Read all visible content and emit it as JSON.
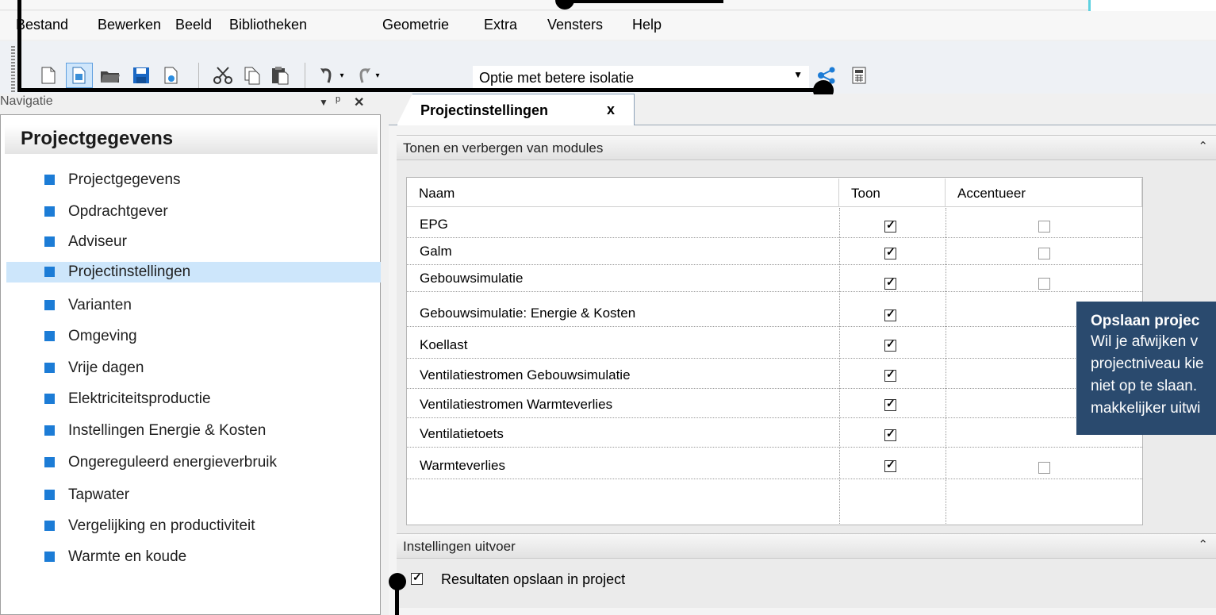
{
  "menu": [
    "Bestand",
    "Bewerken",
    "Beeld",
    "Bibliotheken",
    "Geometrie",
    "Extra",
    "Vensters",
    "Help"
  ],
  "toolbar": {
    "variant_value": "Optie met betere isolatie"
  },
  "navigation": {
    "title": "Navigatie",
    "heading": "Projectgegevens",
    "items": [
      "Projectgegevens",
      "Opdrachtgever",
      "Adviseur",
      "Projectinstellingen",
      "Varianten",
      "Omgeving",
      "Vrije dagen",
      "Elektriciteitsproductie",
      "Instellingen Energie & Kosten",
      "Ongereguleerd energieverbruik",
      "Tapwater",
      "Vergelijking en productiviteit",
      "Warmte en koude"
    ],
    "selected": "Projectinstellingen"
  },
  "tab": {
    "label": "Projectinstellingen",
    "close": "x"
  },
  "modules_section": {
    "title": "Tonen en verbergen van modules",
    "columns": [
      "Naam",
      "Toon",
      "Accentueer"
    ],
    "rows": [
      {
        "name": "EPG",
        "toon": true,
        "accent": false
      },
      {
        "name": "Galm",
        "toon": true,
        "accent": false
      },
      {
        "name": "Gebouwsimulatie",
        "toon": true,
        "accent": false
      },
      {
        "name": "Gebouwsimulatie: Energie &  Kosten",
        "toon": true,
        "accent": false
      },
      {
        "name": "Koellast",
        "toon": true,
        "accent": false
      },
      {
        "name": "Ventilatiestromen Gebouwsimulatie",
        "toon": true,
        "accent": false
      },
      {
        "name": "Ventilatiestromen Warmteverlies",
        "toon": true,
        "accent": false
      },
      {
        "name": "Ventilatietoets",
        "toon": true,
        "accent": false
      },
      {
        "name": "Warmteverlies",
        "toon": true,
        "accent": false
      }
    ]
  },
  "output_section": {
    "title": "Instellingen uitvoer",
    "checkbox_label": "Resultaten opslaan in project",
    "checked": true
  },
  "tooltip": {
    "title": "Opslaan projec",
    "lines": [
      "Wil je afwijken v",
      "projectniveau kie",
      "niet op te slaan.",
      "makkelijker uitwi"
    ]
  },
  "colors": {
    "nav_square": "#1c7cd6",
    "selection": "#cde6fb",
    "tooltip_bg": "#2a4a6e",
    "teal_box": "#5ed1e0"
  }
}
